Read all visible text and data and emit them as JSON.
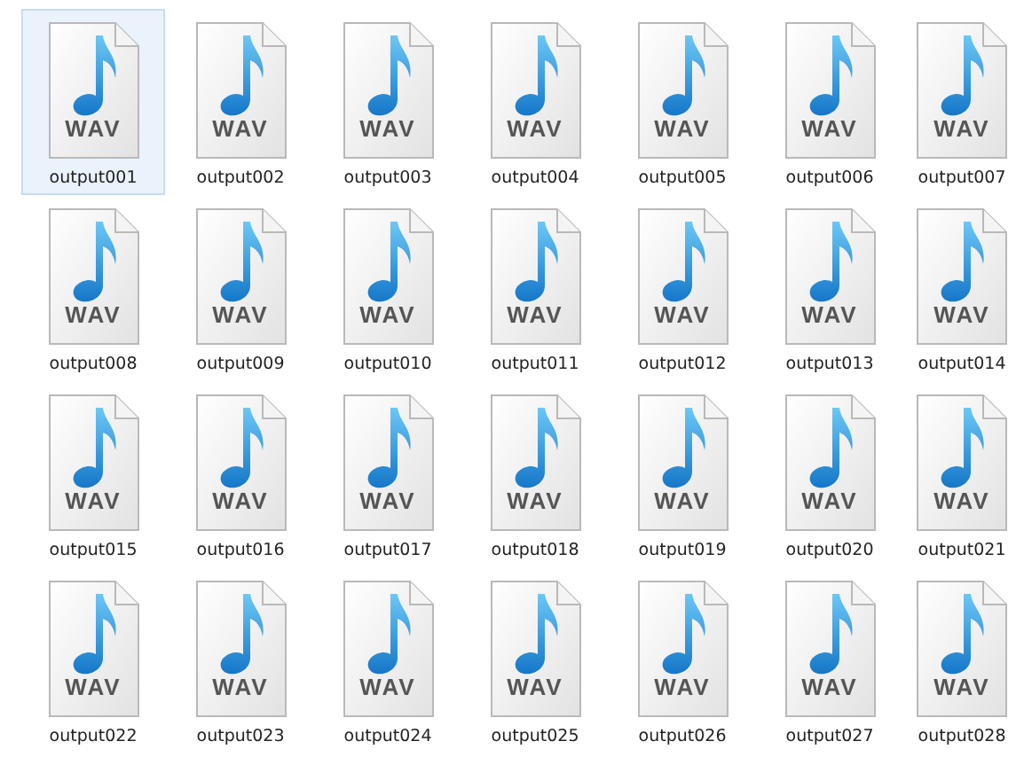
{
  "files": [
    {
      "name": "output001",
      "badge": "WAV",
      "selected": true
    },
    {
      "name": "output002",
      "badge": "WAV",
      "selected": false
    },
    {
      "name": "output003",
      "badge": "WAV",
      "selected": false
    },
    {
      "name": "output004",
      "badge": "WAV",
      "selected": false
    },
    {
      "name": "output005",
      "badge": "WAV",
      "selected": false
    },
    {
      "name": "output006",
      "badge": "WAV",
      "selected": false
    },
    {
      "name": "output007",
      "badge": "WAV",
      "selected": false
    },
    {
      "name": "output008",
      "badge": "WAV",
      "selected": false
    },
    {
      "name": "output009",
      "badge": "WAV",
      "selected": false
    },
    {
      "name": "output010",
      "badge": "WAV",
      "selected": false
    },
    {
      "name": "output011",
      "badge": "WAV",
      "selected": false
    },
    {
      "name": "output012",
      "badge": "WAV",
      "selected": false
    },
    {
      "name": "output013",
      "badge": "WAV",
      "selected": false
    },
    {
      "name": "output014",
      "badge": "WAV",
      "selected": false
    },
    {
      "name": "output015",
      "badge": "WAV",
      "selected": false
    },
    {
      "name": "output016",
      "badge": "WAV",
      "selected": false
    },
    {
      "name": "output017",
      "badge": "WAV",
      "selected": false
    },
    {
      "name": "output018",
      "badge": "WAV",
      "selected": false
    },
    {
      "name": "output019",
      "badge": "WAV",
      "selected": false
    },
    {
      "name": "output020",
      "badge": "WAV",
      "selected": false
    },
    {
      "name": "output021",
      "badge": "WAV",
      "selected": false
    },
    {
      "name": "output022",
      "badge": "WAV",
      "selected": false
    },
    {
      "name": "output023",
      "badge": "WAV",
      "selected": false
    },
    {
      "name": "output024",
      "badge": "WAV",
      "selected": false
    },
    {
      "name": "output025",
      "badge": "WAV",
      "selected": false
    },
    {
      "name": "output026",
      "badge": "WAV",
      "selected": false
    },
    {
      "name": "output027",
      "badge": "WAV",
      "selected": false
    },
    {
      "name": "output028",
      "badge": "WAV",
      "selected": false
    }
  ]
}
